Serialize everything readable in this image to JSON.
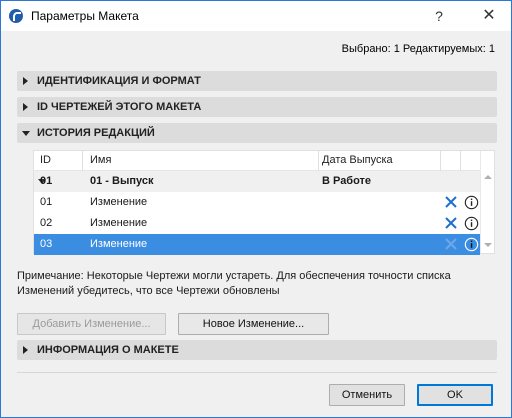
{
  "window": {
    "title": "Параметры Макета",
    "help_label": "?",
    "close_label": "✕"
  },
  "selection_info": "Выбрано: 1 Редактируемых: 1",
  "sections": {
    "identification": "ИДЕНТИФИКАЦИЯ И ФОРМАТ",
    "drawing_ids": "ID ЧЕРТЕЖЕЙ ЭТОГО МАКЕТА",
    "revision_history": "ИСТОРИЯ РЕДАКЦИЙ",
    "layout_info": "ИНФОРМАЦИЯ О МАКЕТЕ"
  },
  "table": {
    "columns": [
      "ID",
      "Имя",
      "Дата Выпуска"
    ],
    "group": {
      "id": "01",
      "name": "01 - Выпуск",
      "date": "В Работе"
    },
    "rows": [
      {
        "id": "01",
        "name": "Изменение",
        "selected": false
      },
      {
        "id": "02",
        "name": "Изменение",
        "selected": false
      },
      {
        "id": "03",
        "name": "Изменение",
        "selected": true
      }
    ],
    "row_icons": [
      "delete-icon",
      "info-icon"
    ]
  },
  "note": "Примечание: Некоторые Чертежи могли устареть. Для обеспечения точности списка Изменений убедитесь, что все Чертежи обновлены",
  "buttons": {
    "add_change": "Добавить Изменение...",
    "new_change": "Новое Изменение...",
    "cancel": "Отменить",
    "ok": "OK"
  },
  "colors": {
    "accent": "#3b8de2",
    "icon_blue": "#1f6fd0",
    "section_bg": "#dcdcdc"
  }
}
